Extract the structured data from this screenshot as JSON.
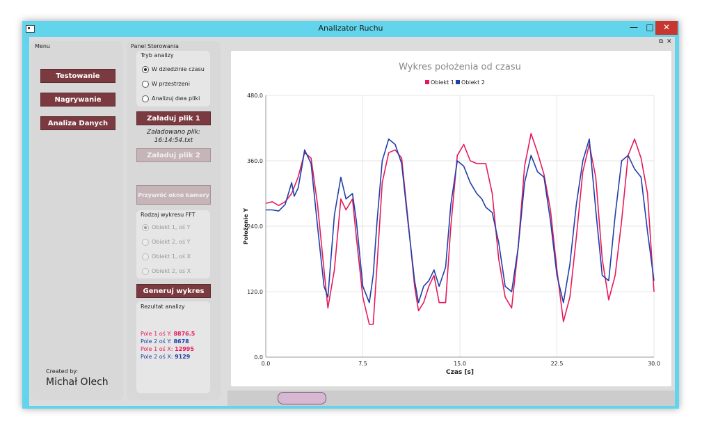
{
  "window": {
    "title": "Analizator Ruchu"
  },
  "menu": {
    "title": "Menu",
    "buttons": [
      "Testowanie",
      "Nagrywanie",
      "Analiza Danych"
    ],
    "created_by": "Created by:",
    "author": "Michał Olech"
  },
  "control": {
    "title": "Panel Sterowania",
    "mode_group": {
      "title": "Tryb analizy",
      "options": [
        "W dziedzinie czasu",
        "W przestrzeni",
        "Analizuj dwa pliki"
      ],
      "selected": 0
    },
    "load1_label": "Załaduj plik 1",
    "loaded_text": "Załadowano plik:",
    "loaded_file": "16:14:54.txt",
    "load2_label": "Załaduj plik 2",
    "restore_camera_label": "Przywróć okno kamery",
    "fft_group": {
      "title": "Rodzaj wykresu FFT",
      "options": [
        "Obiekt 1, oś Y",
        "Obiekt 2, oś Y",
        "Obiekt 1, oś X",
        "Obiekt 2, oś X"
      ],
      "selected": 0
    },
    "generate_label": "Generuj wykres",
    "results": {
      "title": "Rezultat analizy",
      "rows": [
        {
          "label": "Pole 1 oś Y:",
          "value": "8876.5",
          "color": "#e6195a"
        },
        {
          "label": "Pole 2 oś Y:",
          "value": "8678",
          "color": "#1f3fa8"
        },
        {
          "label": "Pole 1 oś X:",
          "value": "12995",
          "color": "#e6195a"
        },
        {
          "label": "Pole 2 oś X:",
          "value": "9129",
          "color": "#1f3fa8"
        }
      ]
    }
  },
  "chart_data": {
    "type": "line",
    "title": "Wykres położenia od czasu",
    "xlabel": "Czas [s]",
    "ylabel": "Położenie Y",
    "xlim": [
      0,
      30
    ],
    "ylim": [
      0,
      480
    ],
    "xticks": [
      "0.0",
      "7.5",
      "15.0",
      "22.5",
      "30.0"
    ],
    "yticks": [
      "0.0",
      "120.0",
      "240.0",
      "360.0",
      "480.0"
    ],
    "grid": true,
    "legend": "top-center",
    "series": [
      {
        "name": "Obiekt 1",
        "color": "#e6195a",
        "x": [
          0,
          0.5,
          1.0,
          1.5,
          2.0,
          2.5,
          3.0,
          3.5,
          4.0,
          4.5,
          4.8,
          5.3,
          5.8,
          6.2,
          6.7,
          7.0,
          7.5,
          8.0,
          8.3,
          8.6,
          9.0,
          9.5,
          10.0,
          10.5,
          11.0,
          11.5,
          11.8,
          12.2,
          12.6,
          13.0,
          13.4,
          13.9,
          14.3,
          14.8,
          15.3,
          15.8,
          16.3,
          16.7,
          17.0,
          17.5,
          18.0,
          18.5,
          19.0,
          19.5,
          20.0,
          20.5,
          21.0,
          21.5,
          22.0,
          22.5,
          23.0,
          23.5,
          24.0,
          24.5,
          25.0,
          25.5,
          26.0,
          26.5,
          27.0,
          27.5,
          28.0,
          28.5,
          29.0,
          29.5,
          30.0
        ],
        "y": [
          282,
          285,
          278,
          285,
          300,
          330,
          375,
          365,
          280,
          160,
          90,
          160,
          290,
          270,
          290,
          220,
          110,
          60,
          60,
          170,
          320,
          375,
          380,
          365,
          250,
          130,
          85,
          100,
          130,
          150,
          100,
          100,
          240,
          370,
          390,
          360,
          355,
          355,
          355,
          300,
          180,
          110,
          90,
          200,
          350,
          410,
          375,
          335,
          270,
          160,
          65,
          110,
          220,
          340,
          390,
          330,
          180,
          105,
          150,
          250,
          370,
          400,
          365,
          300,
          120
        ]
      },
      {
        "name": "Obiekt 2",
        "color": "#1f3fa8",
        "x": [
          0,
          0.5,
          1.0,
          1.5,
          2.0,
          2.2,
          2.5,
          2.8,
          3.0,
          3.5,
          4.0,
          4.5,
          4.8,
          5.3,
          5.8,
          6.2,
          6.7,
          7.0,
          7.5,
          8.0,
          8.3,
          8.6,
          9.0,
          9.5,
          10.0,
          10.5,
          11.0,
          11.5,
          11.8,
          12.2,
          12.6,
          13.0,
          13.4,
          13.9,
          14.3,
          14.8,
          15.3,
          15.8,
          16.3,
          16.7,
          17.0,
          17.5,
          18.0,
          18.5,
          19.0,
          19.5,
          20.0,
          20.5,
          21.0,
          21.5,
          22.0,
          22.5,
          23.0,
          23.5,
          24.0,
          24.5,
          25.0,
          25.5,
          26.0,
          26.5,
          27.0,
          27.5,
          28.0,
          28.5,
          29.0,
          29.5,
          30.0
        ],
        "y": [
          270,
          270,
          268,
          280,
          320,
          295,
          310,
          350,
          380,
          355,
          240,
          130,
          110,
          260,
          330,
          290,
          300,
          250,
          130,
          100,
          150,
          250,
          360,
          400,
          390,
          355,
          245,
          140,
          100,
          130,
          140,
          160,
          130,
          165,
          280,
          360,
          350,
          320,
          300,
          290,
          275,
          265,
          210,
          130,
          120,
          200,
          320,
          370,
          340,
          330,
          250,
          150,
          100,
          170,
          280,
          360,
          400,
          270,
          150,
          140,
          260,
          360,
          370,
          345,
          330,
          230,
          140
        ]
      }
    ]
  }
}
